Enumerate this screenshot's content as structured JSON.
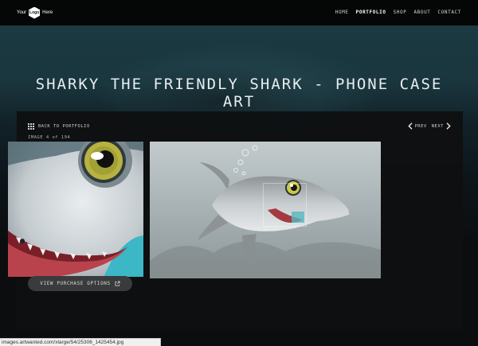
{
  "logo": {
    "text_left": "Your",
    "text_center": "Logo",
    "text_right": "Here"
  },
  "nav": {
    "items": [
      {
        "label": "HOME",
        "active": false
      },
      {
        "label": "PORTFOLIO",
        "active": true
      },
      {
        "label": "SHOP",
        "active": false
      },
      {
        "label": "ABOUT",
        "active": false
      },
      {
        "label": "CONTACT",
        "active": false
      }
    ]
  },
  "page": {
    "title": "SHARKY THE FRIENDLY SHARK - PHONE CASE ART"
  },
  "gallery": {
    "back_label": "BACK TO PORTFOLIO",
    "image_counter": "IMAGE 4 of 194",
    "prev_label": "PREV",
    "next_label": "NEXT",
    "purchase_label": "VIEW PURCHASE OPTIONS"
  },
  "status_bar": {
    "url": "images.artwanted.com/xlarge/54/25306_1425454.jpg"
  },
  "colors": {
    "accent": "#3a3b3c",
    "background": "#0b0d0e"
  }
}
